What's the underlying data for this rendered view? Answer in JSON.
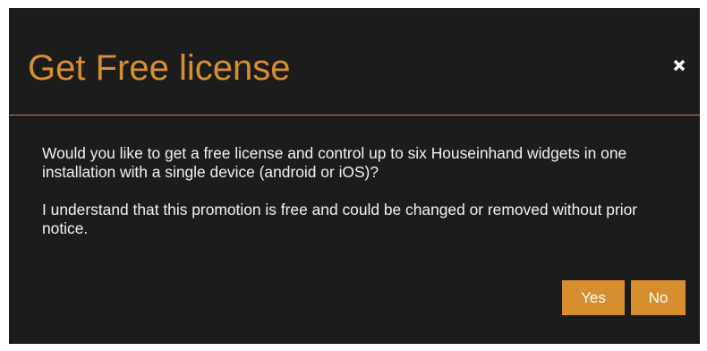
{
  "dialog": {
    "title": "Get Free license",
    "close_icon": "close-icon",
    "paragraphs": [
      "Would you like to get a free license and control up to six Houseinhand widgets in one installation with a single device (android or iOS)?",
      "I understand that this promotion is free and could be changed or removed without prior notice."
    ],
    "buttons": {
      "yes_label": "Yes",
      "no_label": "No"
    }
  },
  "colors": {
    "background": "#1d1c1c",
    "accent": "#d58f2f",
    "text": "#f2f2f2"
  }
}
